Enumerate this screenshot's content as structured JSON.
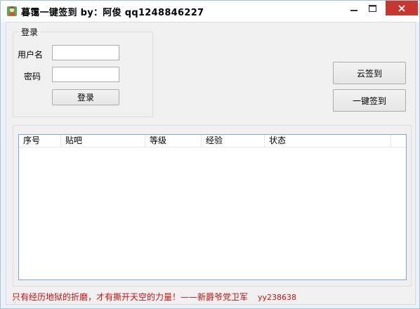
{
  "window": {
    "title": "暮霭一键签到   by：阿俊    qq1248846227",
    "controls": {
      "minimize": "—",
      "maximize": "☐",
      "close": "✕"
    },
    "close_color": "#c7372f"
  },
  "login_group": {
    "legend": "登录",
    "username_label": "用户名",
    "password_label": "密码",
    "username_value": "",
    "password_value": "",
    "login_button": "登录"
  },
  "actions": {
    "cloud_signin": "云签到",
    "one_click_signin": "一键签到"
  },
  "table": {
    "columns": [
      "序号",
      "贴吧",
      "等级",
      "经验",
      "状态"
    ],
    "rows": []
  },
  "footer": {
    "quote": "只有经历地狱的折磨，才有撕开天空的力量！——新爵爷党卫军",
    "tag": "yy238638",
    "color": "#d01010"
  }
}
